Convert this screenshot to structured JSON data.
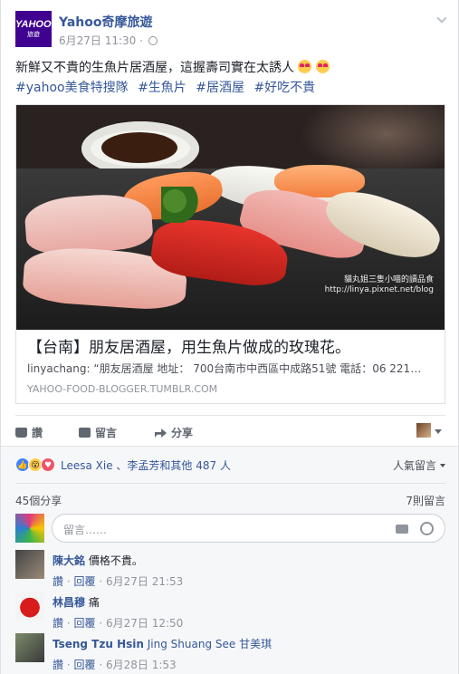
{
  "post": {
    "page_name": "Yahoo奇摩旅遊",
    "logo_text": "YAHOO!",
    "logo_sub": "旅遊",
    "date": "6月27日 11:30",
    "separator": "·",
    "text": "新鮮又不貴的生魚片居酒屋，這握壽司實在太誘人",
    "hashtags": [
      "#yahoo美食特搜隊",
      "#生魚片",
      "#居酒屋",
      "#好吃不貴"
    ]
  },
  "link": {
    "watermark_line1": "貓丸姐三隻小喵的讀品食",
    "watermark_line2": "http://linya.pixnet.net/blog",
    "title": "【台南】朋友居酒屋，用生魚片做成的玫瑰花。",
    "description": "linyachang: “朋友居酒屋 地址： 700台南市中西區中成路51號 電話：06 221…",
    "domain": "YAHOO-FOOD-BLOGGER.TUMBLR.COM"
  },
  "actions": {
    "like_label": "讚",
    "comment_label": "留言",
    "share_label": "分享"
  },
  "reactions": {
    "names": "Leesa Xie 、李孟芳和其他 487 人",
    "sort_label": "人氣留言"
  },
  "counts": {
    "shares": "45個分享",
    "comments": "7則留言"
  },
  "composer": {
    "placeholder": "留言……"
  },
  "comments": [
    {
      "name": "陳大銘",
      "text": "價格不貴。",
      "like": "讚",
      "reply": "回覆",
      "time": "6月27日 21:53",
      "dot": "·"
    },
    {
      "name": "林昌穆",
      "text": "痛",
      "like": "讚",
      "reply": "回覆",
      "time": "6月27日 12:50",
      "dot": "·"
    },
    {
      "name": "Tseng Tzu Hsin",
      "text": "Jing Shuang See 甘美琪",
      "like": "讚",
      "reply": "回覆",
      "time": "6月28日 1:53",
      "dot": "·"
    }
  ],
  "colors": {
    "link_blue": "#365899",
    "yahoo_purple": "#400090",
    "like_blue": "#4080ff",
    "love_red": "#f25268"
  }
}
